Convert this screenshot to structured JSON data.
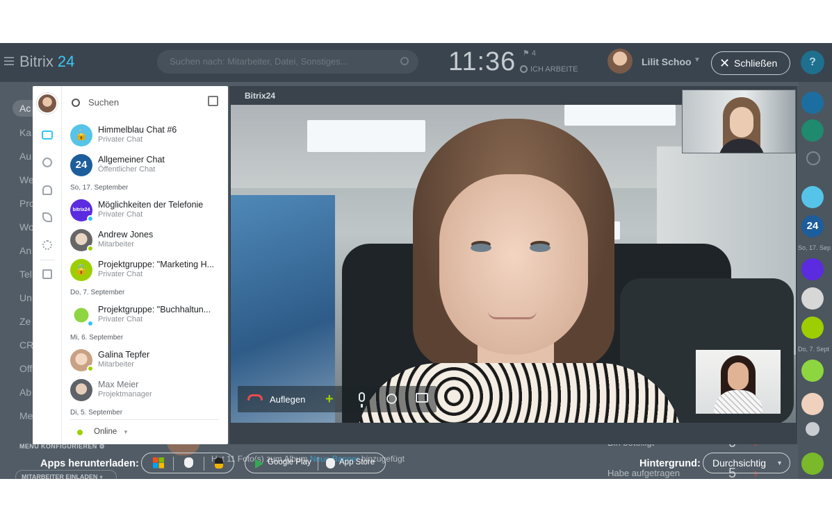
{
  "app": {
    "logo_part1": "Bitrix",
    "logo_part2": "24"
  },
  "header": {
    "search_placeholder": "Suchen nach: Mitarbeiter, Datei, Sonstiges...",
    "clock": "11:36",
    "flag_count": "4",
    "work_status": "ICH ARBEITE",
    "user_name": "Lilit Schoo",
    "close_label": "Schließen",
    "help_label": "?"
  },
  "left_nav": {
    "items": [
      "Ac",
      "Ka",
      "Au",
      "We",
      "Pro",
      "Wo",
      "An",
      "Tel",
      "Un",
      "Ze",
      "CR",
      "Off",
      "Ab",
      "Me"
    ],
    "menu_configure": "MENÜ KONFIGURIEREN",
    "invite": "MITARBEITER EINLADEN"
  },
  "background": {
    "feed_text": "Hat 11 Foto(s) zum Album",
    "feed_link": "Neue Banner",
    "feed_suffix": "hinzugefügt",
    "stats": [
      {
        "label": "Bin beteiligt",
        "value": "0",
        "delta": "0"
      },
      {
        "label": "Habe aufgetragen",
        "value": "5",
        "delta": "3"
      }
    ]
  },
  "chat": {
    "search_label": "Suchen",
    "items": [
      {
        "title": "Himmelblau Chat #6",
        "subtitle": "Privater Chat",
        "avatar_text": "",
        "color": "#56c4e8",
        "icon": "lock-icon"
      },
      {
        "title": "Allgemeiner Chat",
        "subtitle": "Öffentlicher Chat",
        "avatar_text": "24",
        "color": "#1c5d9c",
        "icon": "bitrix24-icon"
      },
      {
        "title": "Möglichkeiten der Telefonie",
        "subtitle": "Privater Chat",
        "avatar_text": "",
        "color": "#5b2be0",
        "icon": "telephony-icon"
      },
      {
        "title": "Andrew Jones",
        "subtitle": "Mitarbeiter",
        "avatar_text": "",
        "color": "#d7d7d7",
        "icon": "user-avatar"
      },
      {
        "title": "Projektgruppe: \"Marketing H...",
        "subtitle": "Privater Chat",
        "avatar_text": "",
        "color": "#9dcf00",
        "icon": "lock-icon"
      },
      {
        "title": "Projektgruppe: \"Buchhaltun...",
        "subtitle": "Privater Chat",
        "avatar_text": "",
        "color": "#ffffff",
        "icon": "piggy-bank-icon"
      },
      {
        "title": "Galina Tepfer",
        "subtitle": "Mitarbeiter",
        "avatar_text": "",
        "color": "#efd1bd",
        "icon": "user-avatar"
      },
      {
        "title": "Max Meier",
        "subtitle": "Projektmanager",
        "avatar_text": "",
        "color": "#c9cdd1",
        "icon": "user-avatar"
      }
    ],
    "dates": [
      "So, 17. September",
      "Do, 7. September",
      "Mi, 6. September",
      "Di, 5. September"
    ],
    "online_label": "Online"
  },
  "video": {
    "logo": "Bitrix24",
    "hangup_label": "Auflegen"
  },
  "bottom": {
    "apps_label": "Apps herunterladen:",
    "google_play": "Google Play",
    "app_store": "App Store",
    "background_label": "Hintergrund:",
    "background_value": "Durchsichtig"
  },
  "right_sidebar": {
    "dates": [
      "So, 17. Sep",
      "Do, 7. Sept"
    ],
    "avatar_text": "24"
  }
}
